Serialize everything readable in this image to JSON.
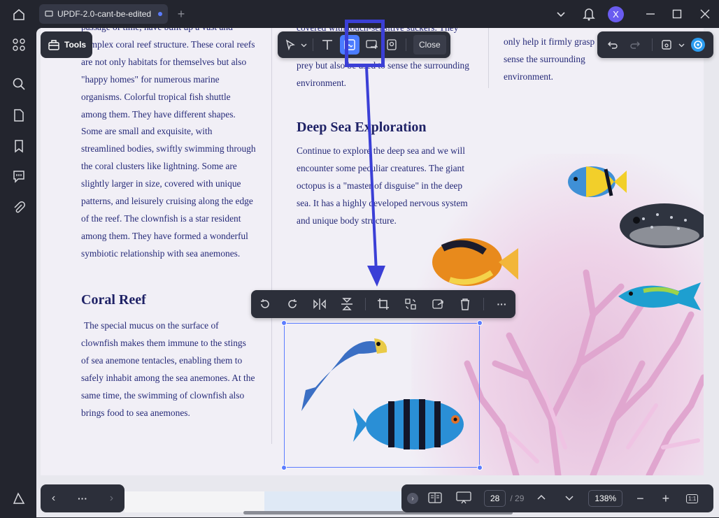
{
  "titlebar": {
    "tab_title": "UPDF-2.0-cant-be-edited",
    "avatar_letter": "X"
  },
  "toolbar": {
    "tools_label": "Tools",
    "close_label": "Close"
  },
  "document": {
    "left_column_top": "passage of time, have built up a vast and complex coral reef structure. These coral reefs are not only habitats for themselves but also \"happy homes\" for numerous marine organisms. Colorful tropical fish shuttle among them. They have different shapes. Some are small and exquisite, with streamlined bodies, swiftly swimming through the coral clusters like lightning. Some are slightly larger in size, covered with unique patterns, and leisurely cruising along the edge of the reef. The clownfish is a star resident among them. They have formed a wonderful symbiotic relationship with sea anemones.",
    "heading_coral": "Coral Reef",
    "coral_text": "The special mucus on the surface of clownfish makes them immune to the stings of sea anemone tentacles, enabling them to safely inhabit among the sea anemones. At the same time, the swimming of clownfish also brings food to sea anemones.",
    "mid_column_top": "prey but also be used to sense the surrounding environment.",
    "mid_column_cut": "covered with touch-sensitive suckers. They",
    "heading_deep": "Deep Sea Exploration",
    "deep_text": "Continue to explore the deep sea and we will encounter some peculiar creatures. The giant octopus is a \"master of disguise\" in the deep sea. It has a highly developed nervous system and unique body structure.",
    "right_column_top": "only help it firmly grasp used to sense the surrounding environment."
  },
  "pagination": {
    "current_page": "28",
    "total_pages": "/ 29",
    "zoom": "138%"
  },
  "colors": {
    "accent": "#5b7cff",
    "annotation": "#3b3fd6",
    "dark_panel": "#2c2f3a"
  }
}
